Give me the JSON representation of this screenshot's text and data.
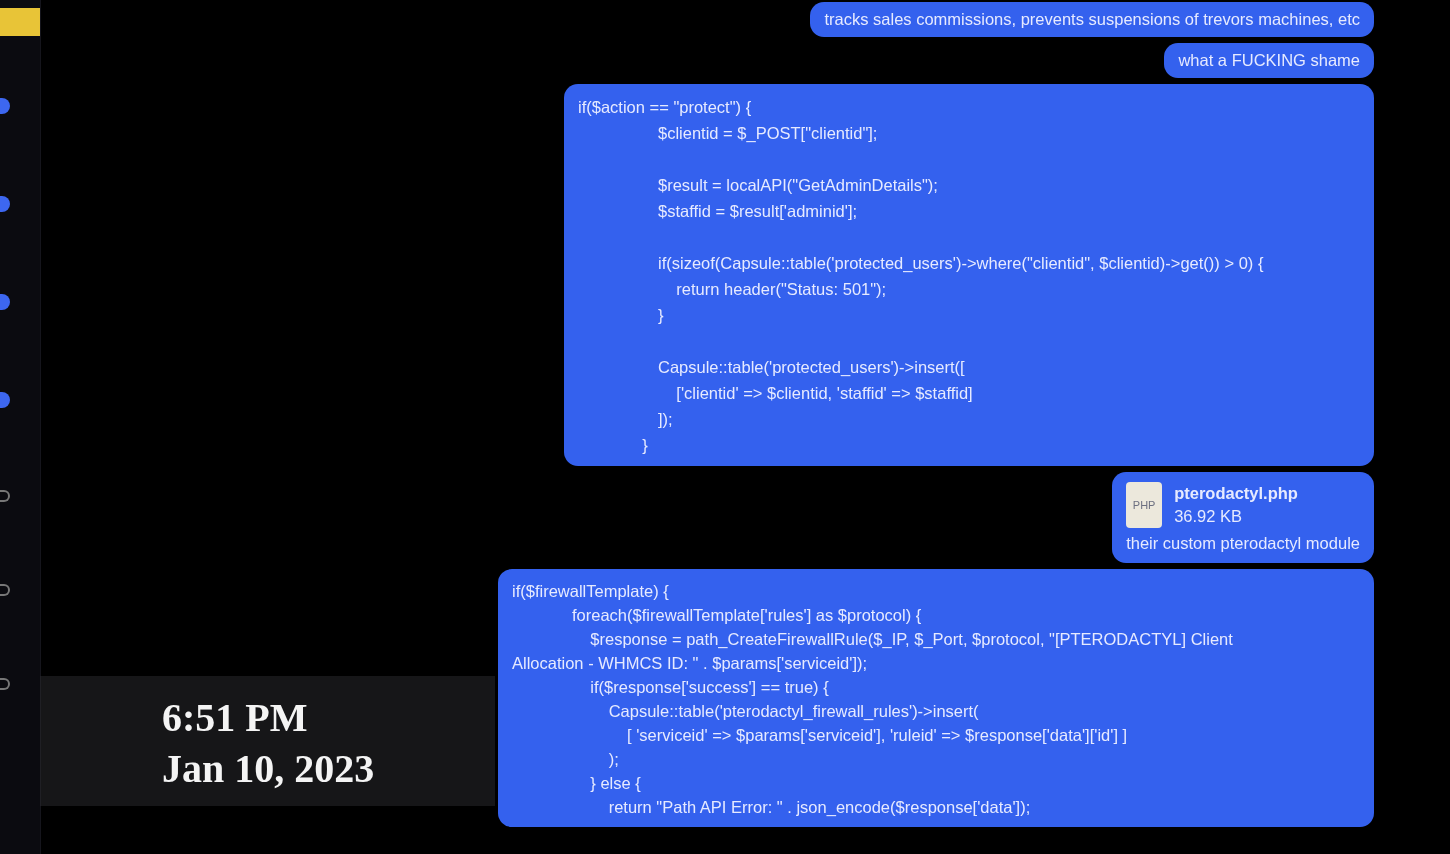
{
  "sidebar": {
    "items": [
      {
        "unread": true
      },
      {
        "unread": true
      },
      {
        "unread": true
      },
      {
        "unread": true
      },
      {
        "unread": false
      },
      {
        "unread": false
      },
      {
        "unread": false
      }
    ]
  },
  "messages": [
    {
      "kind": "text",
      "text": "tracks sales commissions, prevents suspensions of trevors machines, etc"
    },
    {
      "kind": "text",
      "text": "what a FUCKING shame"
    },
    {
      "kind": "code",
      "blocks": [
        [
          "if($action == \"protect\") {",
          "\t$clientid = $_POST[\"clientid\"];"
        ],
        [
          "\t$result = localAPI(\"GetAdminDetails\");",
          "\t$staffid = $result['adminid'];"
        ],
        [
          "\tif(sizeof(Capsule::table('protected_users')->where(\"clientid\", $clientid)->get()) > 0) {",
          "\t    return header(\"Status: 501\");",
          "\t}"
        ],
        [
          "\tCapsule::table('protected_users')->insert([",
          "\t    ['clientid' => $clientid, 'staffid' => $staffid]",
          "\t]);",
          "              }"
        ]
      ]
    },
    {
      "kind": "file",
      "icon_label": "PHP",
      "name": "pterodactyl.php",
      "size": "36.92 KB",
      "caption": "their custom pterodactyl module"
    },
    {
      "kind": "code",
      "blocks": [
        [
          "if($firewallTemplate) {",
          "\tforeach($firewallTemplate['rules'] as $protocol) {",
          "\t    $response = path_CreateFirewallRule($_IP, $_Port, $protocol, \"[PTERODACTYL] Client",
          "Allocation - WHMCS ID: \" . $params['serviceid']);",
          "\t    if($response['success'] == true) {",
          "\t        Capsule::table('pterodactyl_firewall_rules')->insert(",
          "\t            [ 'serviceid' => $params['serviceid'], 'ruleid' => $response['data']['id'] ]",
          "\t        );",
          "\t    } else {",
          "\t        return \"Path API Error: \" . json_encode($response['data']);"
        ]
      ]
    }
  ],
  "caption": {
    "time": "6:51 PM",
    "date": "Jan 10, 2023"
  }
}
